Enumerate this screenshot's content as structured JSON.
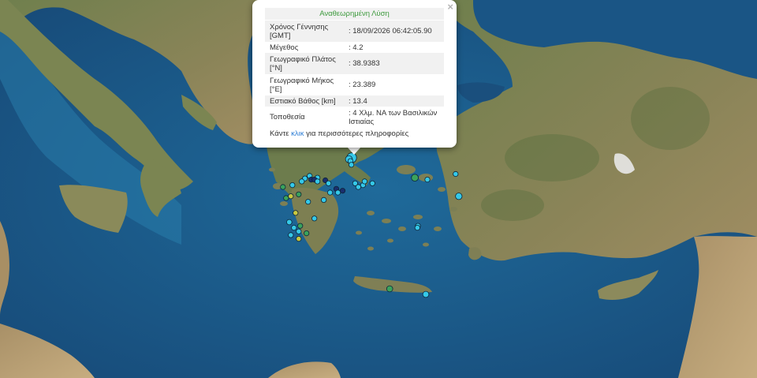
{
  "popup": {
    "title": "Αναθεωρημένη Λύση",
    "close_symbol": "×",
    "rows": [
      {
        "label": "Χρόνος Γέννησης [GMT]",
        "value": ": 18/09/2026 06:42:05.90"
      },
      {
        "label": "Μέγεθος",
        "value": ": 4.2"
      },
      {
        "label": "Γεωγραφικό Πλάτος [°N]",
        "value": ": 38.9383"
      },
      {
        "label": "Γεωγραφικό Μήκος [°E]",
        "value": ": 23.389"
      },
      {
        "label": "Εστιακό Βάθος [km]",
        "value": ": 13.4"
      },
      {
        "label": "Τοποθεσία",
        "value": ": 4 Χλμ. ΝΑ των Βασιλικών Ιστιαίας"
      }
    ],
    "more_prefix": "Κάντε",
    "more_link": "κλικ",
    "more_suffix": "για περισσότερες πληροφορίες"
  },
  "colors": {
    "sea": "#1d5c8c",
    "land": "#6f7d4f",
    "marker_cyan": "#35c9e8",
    "marker_green": "#3aa35c",
    "marker_yellow": "#c9c940",
    "marker_navy": "#1a2f6e"
  },
  "events": [
    {
      "lat": 38.94,
      "lon": 23.39,
      "mag": 4.2,
      "color": "cyan"
    },
    {
      "lat": 38.9,
      "lon": 23.3,
      "mag": 3.5,
      "color": "cyan"
    },
    {
      "lat": 38.85,
      "lon": 23.35,
      "mag": 2.8,
      "color": "cyan"
    },
    {
      "lat": 38.75,
      "lon": 23.38,
      "mag": 2.6,
      "color": "cyan"
    },
    {
      "lat": 38.4,
      "lon": 22.3,
      "mag": 2.7,
      "color": "cyan"
    },
    {
      "lat": 38.45,
      "lon": 22.05,
      "mag": 2.6,
      "color": "cyan"
    },
    {
      "lat": 38.38,
      "lon": 21.9,
      "mag": 2.5,
      "color": "cyan"
    },
    {
      "lat": 38.3,
      "lon": 21.8,
      "mag": 2.5,
      "color": "cyan"
    },
    {
      "lat": 38.35,
      "lon": 22.1,
      "mag": 2.4,
      "color": "navy"
    },
    {
      "lat": 38.35,
      "lon": 22.2,
      "mag": 2.4,
      "color": "navy"
    },
    {
      "lat": 38.33,
      "lon": 22.55,
      "mag": 2.6,
      "color": "navy"
    },
    {
      "lat": 38.3,
      "lon": 22.3,
      "mag": 2.5,
      "color": "cyan"
    },
    {
      "lat": 38.25,
      "lon": 22.65,
      "mag": 2.5,
      "color": "cyan"
    },
    {
      "lat": 38.1,
      "lon": 22.9,
      "mag": 2.6,
      "color": "navy"
    },
    {
      "lat": 38.05,
      "lon": 23.1,
      "mag": 2.5,
      "color": "navy"
    },
    {
      "lat": 38.0,
      "lon": 22.7,
      "mag": 2.5,
      "color": "cyan"
    },
    {
      "lat": 38.25,
      "lon": 23.5,
      "mag": 2.6,
      "color": "cyan"
    },
    {
      "lat": 38.15,
      "lon": 23.6,
      "mag": 2.5,
      "color": "cyan"
    },
    {
      "lat": 38.2,
      "lon": 23.75,
      "mag": 2.5,
      "color": "cyan"
    },
    {
      "lat": 38.3,
      "lon": 23.8,
      "mag": 2.5,
      "color": "cyan"
    },
    {
      "lat": 38.25,
      "lon": 24.05,
      "mag": 2.5,
      "color": "cyan"
    },
    {
      "lat": 38.15,
      "lon": 21.2,
      "mag": 2.4,
      "color": "green"
    },
    {
      "lat": 38.2,
      "lon": 21.5,
      "mag": 2.5,
      "color": "cyan"
    },
    {
      "lat": 37.85,
      "lon": 21.3,
      "mag": 2.5,
      "color": "green"
    },
    {
      "lat": 37.9,
      "lon": 21.45,
      "mag": 2.4,
      "color": "yellow"
    },
    {
      "lat": 37.95,
      "lon": 21.7,
      "mag": 2.5,
      "color": "green"
    },
    {
      "lat": 37.75,
      "lon": 22.0,
      "mag": 2.5,
      "color": "cyan"
    },
    {
      "lat": 37.8,
      "lon": 22.5,
      "mag": 2.5,
      "color": "cyan"
    },
    {
      "lat": 38.0,
      "lon": 22.95,
      "mag": 2.5,
      "color": "cyan"
    },
    {
      "lat": 37.45,
      "lon": 21.6,
      "mag": 2.4,
      "color": "yellow"
    },
    {
      "lat": 37.2,
      "lon": 21.4,
      "mag": 3.1,
      "color": "cyan"
    },
    {
      "lat": 37.3,
      "lon": 22.2,
      "mag": 2.5,
      "color": "cyan"
    },
    {
      "lat": 37.05,
      "lon": 21.55,
      "mag": 2.5,
      "color": "cyan"
    },
    {
      "lat": 37.1,
      "lon": 21.75,
      "mag": 2.4,
      "color": "green"
    },
    {
      "lat": 36.95,
      "lon": 21.7,
      "mag": 2.5,
      "color": "cyan"
    },
    {
      "lat": 36.85,
      "lon": 21.45,
      "mag": 2.5,
      "color": "cyan"
    },
    {
      "lat": 36.75,
      "lon": 21.7,
      "mag": 2.4,
      "color": "yellow"
    },
    {
      "lat": 36.9,
      "lon": 21.95,
      "mag": 2.5,
      "color": "green"
    },
    {
      "lat": 38.4,
      "lon": 25.4,
      "mag": 3.5,
      "color": "green"
    },
    {
      "lat": 38.5,
      "lon": 26.7,
      "mag": 2.6,
      "color": "cyan"
    },
    {
      "lat": 38.35,
      "lon": 25.8,
      "mag": 2.5,
      "color": "cyan"
    },
    {
      "lat": 37.9,
      "lon": 26.8,
      "mag": 3.4,
      "color": "cyan"
    },
    {
      "lat": 37.1,
      "lon": 25.5,
      "mag": 2.6,
      "color": "cyan"
    },
    {
      "lat": 37.05,
      "lon": 25.48,
      "mag": 2.5,
      "color": "cyan"
    },
    {
      "lat": 35.4,
      "lon": 24.6,
      "mag": 3.3,
      "color": "green"
    },
    {
      "lat": 35.25,
      "lon": 25.75,
      "mag": 3.3,
      "color": "cyan"
    }
  ]
}
